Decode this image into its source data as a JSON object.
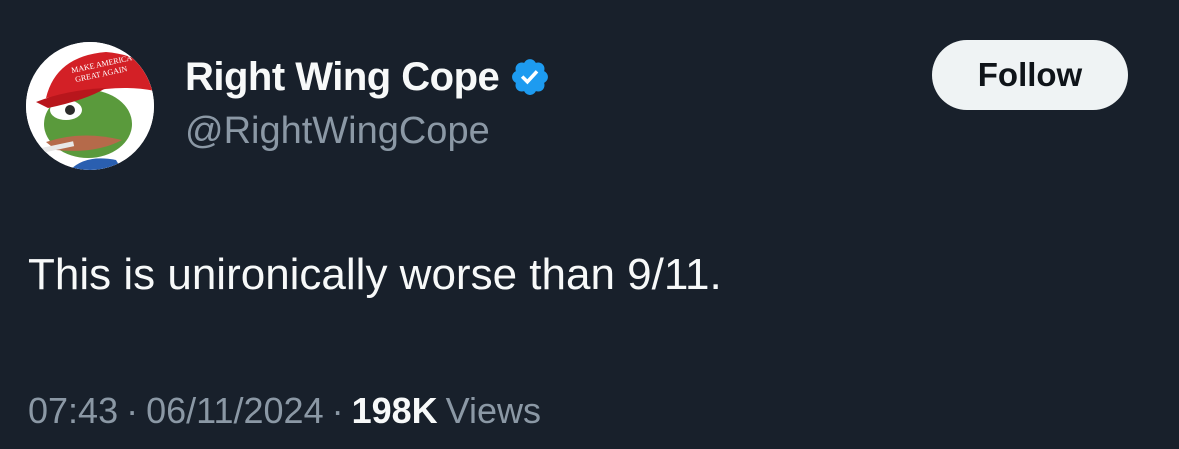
{
  "tweet": {
    "display_name": "Right Wing Cope",
    "handle": "@RightWingCope",
    "follow_label": "Follow",
    "text": "This is unironically worse than 9/11.",
    "time": "07:43",
    "separator": "·",
    "date": "06/11/2024",
    "views_count": "198K",
    "views_label": "Views"
  },
  "avatar": {
    "icon": "pepe-maga-hat-avatar",
    "hat_text_line1": "MAKE AMERICA",
    "hat_text_line2": "GREAT AGAIN"
  },
  "colors": {
    "background": "#18202b",
    "primary_text": "#f7f9f9",
    "secondary_text": "#8b98a5",
    "verified_blue": "#1d9bf0",
    "follow_bg": "#eff3f4"
  }
}
